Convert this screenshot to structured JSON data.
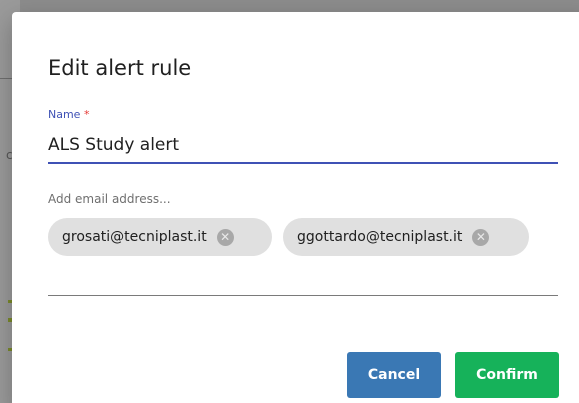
{
  "dialog": {
    "title": "Edit alert rule",
    "name_field": {
      "label": "Name",
      "required_marker": "*",
      "value": "ALS Study alert"
    },
    "email_field": {
      "placeholder": "Add email address...",
      "chips": [
        {
          "label": "grosati@tecniplast.it",
          "remove_icon": "cancel-circle-icon"
        },
        {
          "label": "ggottardo@tecniplast.it",
          "remove_icon": "cancel-circle-icon"
        }
      ]
    },
    "buttons": {
      "cancel": "Cancel",
      "confirm": "Confirm"
    }
  },
  "background": {
    "partial_char": "c"
  },
  "colors": {
    "accent": "#3f51b5",
    "required": "#e53935",
    "cancel_button": "#3a78b4",
    "confirm_button": "#16b25a",
    "chip_background": "#e0e0e0"
  }
}
